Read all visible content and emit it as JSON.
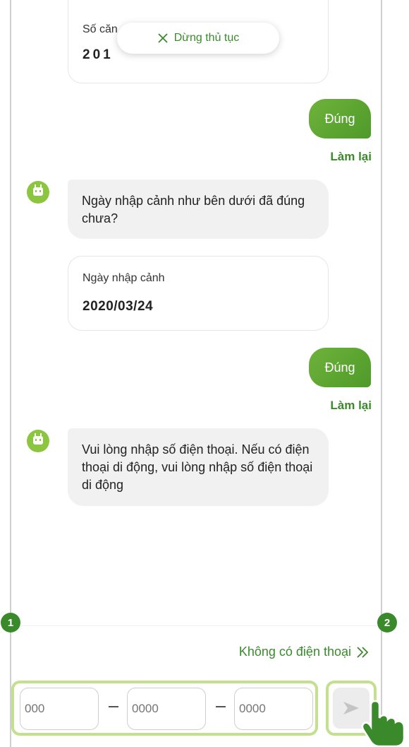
{
  "top_card": {
    "label": "Số căn",
    "value": "201"
  },
  "stop_button": {
    "label": "Dừng thủ tục"
  },
  "messages": [
    {
      "type": "user",
      "text": "Đúng",
      "redo": "Làm lại"
    },
    {
      "type": "bot",
      "text": "Ngày nhập cảnh như bên dưới đã đúng chưa?"
    },
    {
      "type": "card",
      "label": "Ngày nhập cảnh",
      "value": "2020/03/24"
    },
    {
      "type": "user",
      "text": "Đúng",
      "redo": "Làm lại"
    },
    {
      "type": "bot",
      "text": "Vui lòng nhập số điện thoại. Nếu có điện thoại di động, vui lòng nhập số điện thoại di động"
    }
  ],
  "no_phone_link": "Không có điện thoại",
  "phone_input": {
    "part1_placeholder": "000",
    "part2_placeholder": "0000",
    "part3_placeholder": "0000"
  },
  "badges": {
    "input": "1",
    "send": "2"
  },
  "colors": {
    "accent": "#3a8a2c",
    "bubble_green": "#6fb23b",
    "highlight": "#c3e08e",
    "bot_avatar": "#8cc63f"
  }
}
